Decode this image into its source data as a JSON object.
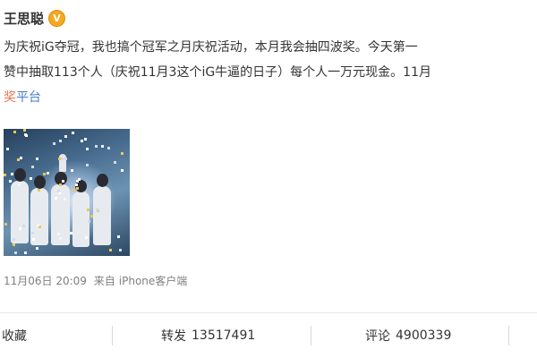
{
  "post": {
    "author": "王思聪",
    "verified_badge": "V",
    "lines": [
      "为庆祝iG夺冠，我也搞个冠军之月庆祝活动，本月我会抽四波奖。今天第一",
      "赞中抽取113个人（庆祝11月3这个iG牛逼的日子）每个人一万元现金。11月"
    ],
    "line3_red": "奖",
    "line3_blue": "平台",
    "timestamp": "11月06日 20:09",
    "source_prefix": "来自",
    "source": "iPhone客户端",
    "colors": {
      "badge": "#f4a91f",
      "link_red": "#eb7350",
      "link_blue": "#3f7ec9"
    }
  },
  "actions": {
    "collect": {
      "label": "收藏"
    },
    "repost": {
      "label": "转发",
      "count": "13517491"
    },
    "comment": {
      "label": "评论",
      "count": "4900339"
    }
  }
}
